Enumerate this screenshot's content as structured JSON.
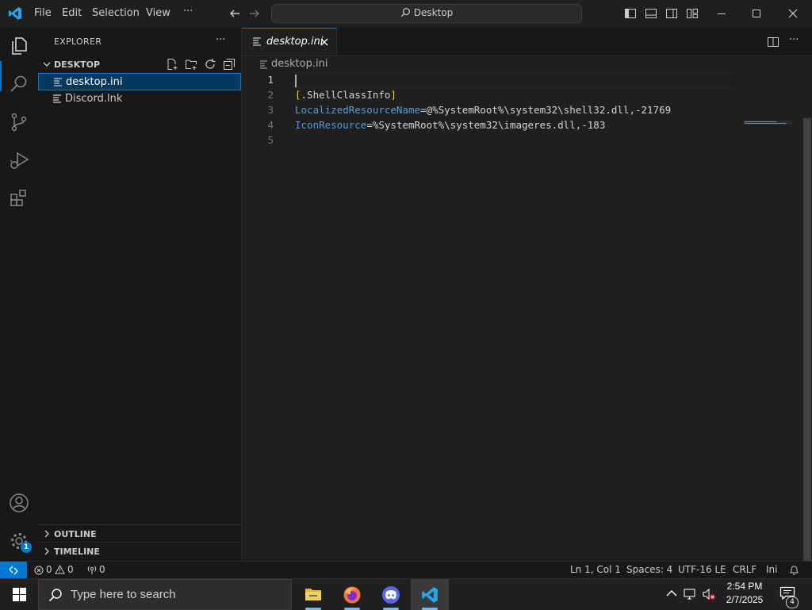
{
  "window": {
    "menu": [
      "File",
      "Edit",
      "Selection",
      "View"
    ],
    "more": "···",
    "command_center": "Desktop"
  },
  "activity_bar": {
    "icons": [
      "files-icon",
      "search-icon",
      "source-control-icon",
      "run-debug-icon",
      "extensions-icon",
      "account-icon",
      "settings-gear-icon"
    ],
    "settings_badge": "1"
  },
  "sidebar": {
    "title": "EXPLORER",
    "more": "···",
    "folder": "DESKTOP",
    "files": [
      "desktop.ini",
      "Discord.lnk"
    ],
    "outline": "OUTLINE",
    "timeline": "TIMELINE"
  },
  "editor": {
    "tab_label": "desktop.ini",
    "breadcrumb": "desktop.ini",
    "line_numbers": [
      "1",
      "2",
      "3",
      "4",
      "5"
    ],
    "lines": {
      "l2_open": "[",
      "l2_section": ".ShellClassInfo",
      "l2_close": "]",
      "l3_key": "LocalizedResourceName",
      "l3_eq": "=",
      "l3_val": "@%SystemRoot%\\system32\\shell32.dll,-21769",
      "l4_key": "IconResource",
      "l4_eq": "=",
      "l4_val": "%SystemRoot%\\system32\\imageres.dll,-183"
    }
  },
  "statusbar": {
    "errors": "0",
    "warnings": "0",
    "ports": "0",
    "position": "Ln 1, Col 1",
    "spaces": "Spaces: 4",
    "encoding": "UTF-16 LE",
    "eol": "CRLF",
    "language": "Ini"
  },
  "taskbar": {
    "search_placeholder": "Type here to search",
    "apps": [
      "file-explorer-icon",
      "firefox-icon",
      "discord-icon",
      "vscode-icon"
    ],
    "time": "2:54 PM",
    "date": "2/7/2025",
    "notification_count": "4"
  },
  "colors": {
    "accent": "#0078d4",
    "background": "#1f1f1f",
    "sidebar": "#181818",
    "ini_key": "#569cd6",
    "ini_bracket": "#f1d700"
  }
}
